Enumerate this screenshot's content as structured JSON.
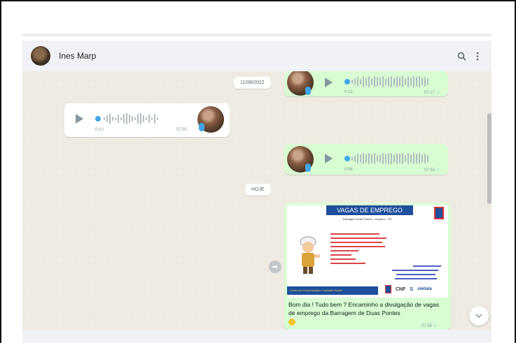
{
  "header": {
    "contact_name": "Ines Marp",
    "icons": [
      "search-icon",
      "kebab-menu-icon"
    ]
  },
  "messages": {
    "date_1": "11/08/2022",
    "voice_out_1": {
      "duration": "0:13",
      "time": "07:17"
    },
    "voice_in_1": {
      "duration": "0:10",
      "time": "07:50"
    },
    "voice_out_2": {
      "duration": "0:06",
      "time": "07:53"
    },
    "date_2": "HOJE",
    "image_out": {
      "poster_title": "VAGAS DE EMPREGO",
      "poster_subtitle": "Barragem Duas Pontes – Amparo – SP",
      "poster_footer": "Centro de Comunicação e Inclusão Social",
      "poster_logos": [
        "CNF",
        "S",
        "stellata"
      ],
      "caption": "Bom dia ! Tudo bem ? Encaminho a divulgação de vagas de emprego da Barragem de Duas Pontes",
      "time": "07:58"
    }
  },
  "colors": {
    "outgoing": "#d9fdd3",
    "incoming": "#ffffff",
    "chat_bg": "#efeae2",
    "accent": "#40a5e8",
    "tick": "#53bdeb"
  }
}
